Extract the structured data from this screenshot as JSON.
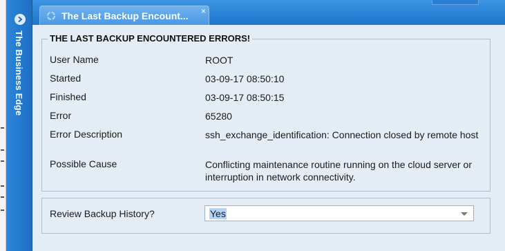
{
  "sidebar": {
    "title": "The Business Edge"
  },
  "tab": {
    "title": "The Last Backup Encount...",
    "close_glyph": "×"
  },
  "panel": {
    "heading": "THE LAST BACKUP ENCOUNTERED ERRORS!",
    "rows": [
      {
        "label": "User Name",
        "value": "ROOT"
      },
      {
        "label": "Started",
        "value": "03-09-17 08:50:10"
      },
      {
        "label": "Finished",
        "value": "03-09-17 08:50:15"
      },
      {
        "label": "Error",
        "value": "65280"
      },
      {
        "label": "Error Description",
        "value": "ssh_exchange_identification: Connection closed by remote host"
      },
      {
        "label": "Possible Cause",
        "value": "Conflicting maintenance routine running on the cloud server or interruption in network connectivity."
      }
    ]
  },
  "review": {
    "label": "Review Backup History?",
    "selected": "Yes"
  },
  "icons": {
    "sidebar_toggle": "chevron-right-icon",
    "tab": "refresh-icon",
    "close": "close-icon",
    "select": "chevron-down-icon"
  },
  "colors": {
    "accent": "#1f74cc",
    "tab": "#4a98e4",
    "content_bg": "#e4edf5",
    "selection": "#b3d4f6"
  }
}
